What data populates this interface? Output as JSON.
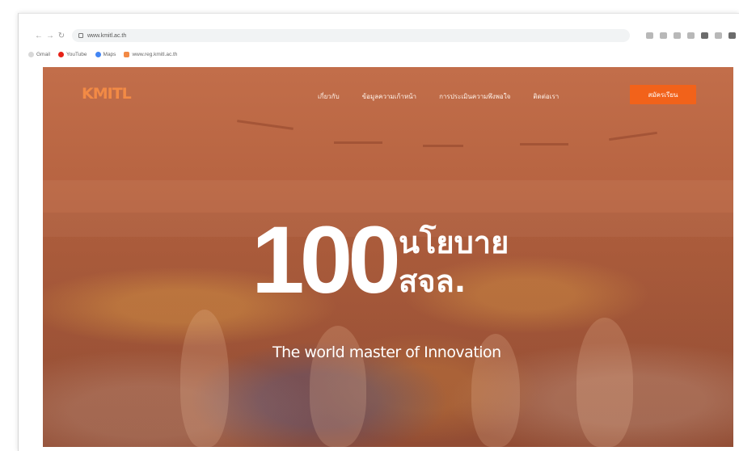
{
  "browser": {
    "url": "www.kmitl.ac.th",
    "bookmarks": [
      {
        "label": "Gmail",
        "color": "#d8d8d8"
      },
      {
        "label": "YouTube",
        "color": "#e62117"
      },
      {
        "label": "Maps",
        "color": "#4285f4"
      },
      {
        "label": "www.reg.kmitl.ac.th",
        "color": "#f28a45"
      }
    ]
  },
  "site": {
    "logo": "KMITL",
    "nav": [
      "เกี่ยวกับ",
      "ข้อมูลความเก้าหน้า",
      "การประเมินความพึงพอใจ",
      "ติดต่อเรา"
    ],
    "cta_label": "สมัครเรียน",
    "accent": "#f2621a"
  },
  "hero": {
    "number": "100",
    "title_line1": "นโยบาย",
    "title_line2": "สจล.",
    "tagline": "The world master of Innovation"
  }
}
